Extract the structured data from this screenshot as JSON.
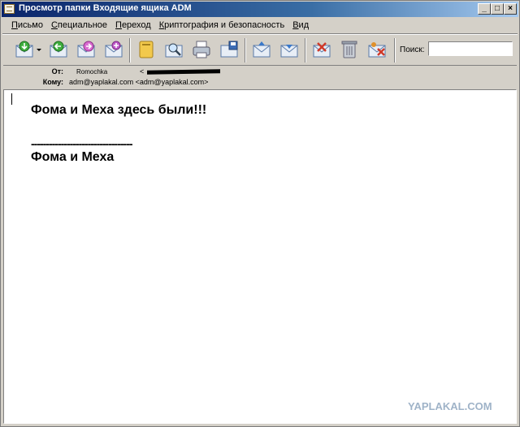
{
  "window": {
    "title": "Просмотр папки Входящие ящика ADM"
  },
  "titlebar": {
    "min_glyph": "_",
    "max_glyph": "□",
    "close_glyph": "×"
  },
  "menu": [
    "Письмо",
    "Специальное",
    "Переход",
    "Криптография и безопасность",
    "Вид"
  ],
  "toolbar": {
    "icons": [
      "receive-icon",
      "reply-icon",
      "reply-all-icon",
      "forward-icon",
      "address-book-icon",
      "find-icon",
      "print-icon",
      "save-icon",
      "previous-icon",
      "next-icon",
      "delete-icon",
      "trash-icon",
      "junk-icon"
    ],
    "search_label": "Поиск:",
    "search_value": ""
  },
  "headers": {
    "from_label": "От:",
    "from_value": "Romochka",
    "from_addr_prefix": "<",
    "to_label": "Кому:",
    "to_value": "adm@yaplakal.com <adm@yaplakal.com>"
  },
  "message": {
    "line1": "Фома и Меха здесь были!!!",
    "separator": "----------------------------------",
    "signature": "Фома и Меха"
  },
  "watermark": "YAPLAKAL.COM",
  "colors": {
    "titlebar": "#0a246a",
    "window_bg": "#d4d0c8",
    "body_bg": "#ffffff",
    "watermark": "#9fb3c8"
  }
}
